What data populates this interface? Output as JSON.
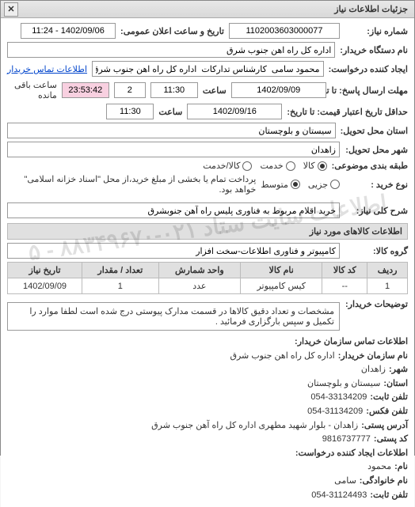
{
  "window": {
    "title": "جزئیات اطلاعات نیاز",
    "close": "✕"
  },
  "fields": {
    "requestNumber": {
      "label": "شماره نیاز:",
      "value": "1102003603000077"
    },
    "announceDateTime": {
      "label": "تاریخ و ساعت اعلان عمومی:",
      "value": "1402/09/06 - 11:24"
    },
    "orgName": {
      "label": "نام دستگاه خریدار:",
      "value": "اداره کل راه اهن جنوب شرق"
    },
    "requester": {
      "label": "ایجاد کننده درخواست:",
      "value": "محمود سامی  کارشناس تدارکات  اداره کل راه اهن جنوب شرق"
    },
    "buyerContactLink": "اطلاعات تماس خریدار",
    "responseDeadline": {
      "label": "مهلت ارسال پاسخ: تا تاریخ:",
      "date": "1402/09/09",
      "timeLabel": "ساعت",
      "time": "11:30",
      "count": "2",
      "countdown": "23:53:42",
      "remaining": "ساعت باقی مانده"
    },
    "validityDeadline": {
      "label": "حداقل تاریخ اعتبار قیمت: تا تاریخ:",
      "date": "1402/09/16",
      "timeLabel": "ساعت",
      "time": "11:30"
    },
    "deliveryProvince": {
      "label": "استان محل تحویل:",
      "value": "سیستان و بلوچستان"
    },
    "deliveryCity": {
      "label": "شهر محل تحویل:",
      "value": "زاهدان"
    },
    "categoryLabel": "طبقه بندی موضوعی:",
    "categoryOptions": [
      {
        "label": "کالا",
        "checked": true
      },
      {
        "label": "خدمت",
        "checked": false
      },
      {
        "label": "کالا/خدمت",
        "checked": false
      }
    ],
    "purchaseTypeLabel": "نوع خرید :",
    "purchaseTypeOptions": [
      {
        "label": "جزیی",
        "checked": false
      },
      {
        "label": "متوسط",
        "checked": true
      }
    ],
    "purchaseNote": "پرداخت تمام یا بخشی از مبلغ خرید،از محل \"اسناد خزانه اسلامی\" خواهد بود.",
    "generalDesc": {
      "label": "شرح کلی نیاز:",
      "value": "خرید اقلام مربوط به فناوری پلیس راه آهن جنوبشرق"
    }
  },
  "itemsSection": {
    "header": "اطلاعات کالاهای مورد نیاز",
    "groupLabel": "گروه کالا:",
    "groupValue": "کامپیوتر و فناوری اطلاعات-سخت افزار"
  },
  "table": {
    "headers": [
      "ردیف",
      "کد کالا",
      "نام کالا",
      "واحد شمارش",
      "تعداد / مقدار",
      "تاریخ نیاز"
    ],
    "rows": [
      {
        "idx": "1",
        "code": "--",
        "name": "کیس کامپیوتر",
        "unit": "عدد",
        "qty": "1",
        "date": "1402/09/09"
      }
    ]
  },
  "buyerNotes": {
    "label": "توضیحات خریدار:",
    "value": "مشخصات و تعداد دقیق کالاها در قسمت مدارک پیوستی درج شده است لطفا موارد را تکمیل و سپس بارگزاری فرمائید ."
  },
  "contact": {
    "header": "اطلاعات تماس سازمان خریدار:",
    "orgNameLabel": "نام سازمان خریدار:",
    "orgName": "اداره کل راه اهن جنوب شرق",
    "cityLabel": "شهر:",
    "city": "زاهدان",
    "provinceLabel": "استان:",
    "province": "سیستان و بلوچستان",
    "phoneLabel": "تلفن ثابت:",
    "phone": "054-33134209",
    "faxLabel": "تلفن فکس:",
    "fax": "054-31134209",
    "addressLabel": "آدرس پستی:",
    "address": "زاهدان - بلوار شهید مطهری اداره کل راه آهن جنوب شرق",
    "postalLabel": "کد پستی:",
    "postal": "9816737777",
    "requesterHeader": "اطلاعات ایجاد کننده درخواست:",
    "nameLabel": "نام:",
    "name": "محمود",
    "familyLabel": "نام خانوادگی:",
    "family": "سامی",
    "reqPhoneLabel": "تلفن ثابت:",
    "reqPhone": "054-31124493"
  },
  "watermark": "اطلاعات سایت ستاد   ۰۲۱-۸۸۳۴۹۶۷۰ - ۵"
}
